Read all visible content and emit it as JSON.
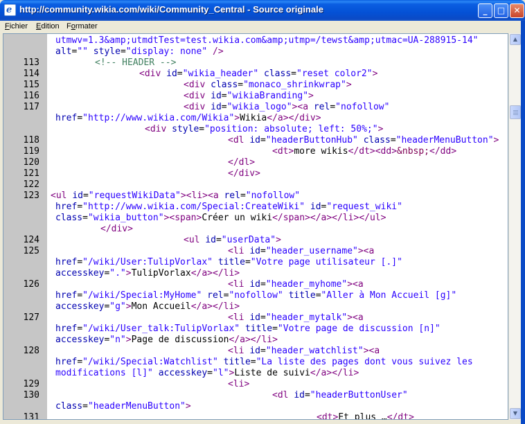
{
  "window": {
    "title": "http://community.wikia.com/wiki/Community_Central - Source originale",
    "icon": "ie-icon",
    "controls": {
      "minimize": "_",
      "maximize": "□",
      "close": "✕"
    }
  },
  "menu": [
    {
      "label": "Fichier",
      "accel": "F"
    },
    {
      "label": "Edition",
      "accel": "E"
    },
    {
      "label": "Formater",
      "accel": "o"
    }
  ],
  "colors": {
    "titlebar": "#0451d6",
    "gutter": "#c6c6c6",
    "tag": "#7f007f",
    "attr_name": "#0000b0",
    "attr_value": "#2a00ff",
    "comment": "#3f7f5f",
    "text": "#000000"
  },
  "source_lines": [
    {
      "num": "",
      "indent": 0,
      "tokens": [
        {
          "t": "utmwv=1.3&amp;utmdtTest=test.wikia.com&amp;utmp=/tewst&amp;utmac=UA-288915-14\"",
          "c": "av"
        }
      ]
    },
    {
      "num": "",
      "indent": 0,
      "tokens": [
        {
          "t": "alt",
          "c": "an"
        },
        {
          "t": "=",
          "c": "tx"
        },
        {
          "t": "\"\"",
          "c": "av"
        },
        {
          "t": " ",
          "c": "tx"
        },
        {
          "t": "style",
          "c": "an"
        },
        {
          "t": "=",
          "c": "tx"
        },
        {
          "t": "\"display: none\"",
          "c": "av"
        },
        {
          "t": " />",
          "c": "tg"
        }
      ]
    },
    {
      "num": "113",
      "indent": 1,
      "tokens": [
        {
          "t": "<!-- HEADER -->",
          "c": "cm"
        }
      ]
    },
    {
      "num": "114",
      "indent": 2,
      "tokens": [
        {
          "t": "<div ",
          "c": "tg"
        },
        {
          "t": "id",
          "c": "an"
        },
        {
          "t": "=",
          "c": "tx"
        },
        {
          "t": "\"wikia_header\"",
          "c": "av"
        },
        {
          "t": " ",
          "c": "tx"
        },
        {
          "t": "class",
          "c": "an"
        },
        {
          "t": "=",
          "c": "tx"
        },
        {
          "t": "\"reset color2\"",
          "c": "av"
        },
        {
          "t": ">",
          "c": "tg"
        }
      ]
    },
    {
      "num": "115",
      "indent": 3,
      "tokens": [
        {
          "t": "<div ",
          "c": "tg"
        },
        {
          "t": "class",
          "c": "an"
        },
        {
          "t": "=",
          "c": "tx"
        },
        {
          "t": "\"monaco_shrinkwrap\"",
          "c": "av"
        },
        {
          "t": ">",
          "c": "tg"
        }
      ]
    },
    {
      "num": "116",
      "indent": 3,
      "tokens": [
        {
          "t": "<div ",
          "c": "tg"
        },
        {
          "t": "id",
          "c": "an"
        },
        {
          "t": "=",
          "c": "tx"
        },
        {
          "t": "\"wikiaBranding\"",
          "c": "av"
        },
        {
          "t": ">",
          "c": "tg"
        }
      ]
    },
    {
      "num": "117",
      "indent": 3,
      "tokens": [
        {
          "t": "<div ",
          "c": "tg"
        },
        {
          "t": "id",
          "c": "an"
        },
        {
          "t": "=",
          "c": "tx"
        },
        {
          "t": "\"wikia_logo\"",
          "c": "av"
        },
        {
          "t": "><a ",
          "c": "tg"
        },
        {
          "t": "rel",
          "c": "an"
        },
        {
          "t": "=",
          "c": "tx"
        },
        {
          "t": "\"nofollow\"",
          "c": "av"
        }
      ]
    },
    {
      "num": "",
      "indent": 0,
      "tokens": [
        {
          "t": "href",
          "c": "an"
        },
        {
          "t": "=",
          "c": "tx"
        },
        {
          "t": "\"http://www.wikia.com/Wikia\"",
          "c": "av"
        },
        {
          "t": ">",
          "c": "tg"
        },
        {
          "t": "Wikia",
          "c": "tx"
        },
        {
          "t": "</a></div>",
          "c": "tg"
        }
      ]
    },
    {
      "num": "",
      "indent": 4,
      "tokens": [
        {
          "t": "<div ",
          "c": "tg"
        },
        {
          "t": "style",
          "c": "an"
        },
        {
          "t": "=",
          "c": "tx"
        },
        {
          "t": "\"position: absolute; left: 50%;\"",
          "c": "av"
        },
        {
          "t": ">",
          "c": "tg"
        }
      ]
    },
    {
      "num": "118",
      "indent": 5,
      "tokens": [
        {
          "t": "<dl ",
          "c": "tg"
        },
        {
          "t": "id",
          "c": "an"
        },
        {
          "t": "=",
          "c": "tx"
        },
        {
          "t": "\"headerButtonHub\"",
          "c": "av"
        },
        {
          "t": " ",
          "c": "tx"
        },
        {
          "t": "class",
          "c": "an"
        },
        {
          "t": "=",
          "c": "tx"
        },
        {
          "t": "\"headerMenuButton\"",
          "c": "av"
        },
        {
          "t": ">",
          "c": "tg"
        }
      ]
    },
    {
      "num": "119",
      "indent": 6,
      "tokens": [
        {
          "t": "<dt>",
          "c": "tg"
        },
        {
          "t": "more wikis",
          "c": "tx"
        },
        {
          "t": "</dt><dd>",
          "c": "tg"
        },
        {
          "t": "&nbsp;",
          "c": "en"
        },
        {
          "t": "</dd>",
          "c": "tg"
        }
      ]
    },
    {
      "num": "120",
      "indent": 5,
      "tokens": [
        {
          "t": "</dl>",
          "c": "tg"
        }
      ]
    },
    {
      "num": "121",
      "indent": 5,
      "tokens": [
        {
          "t": "</div>",
          "c": "tg"
        }
      ]
    },
    {
      "num": "122",
      "indent": 0,
      "tokens": []
    },
    {
      "num": "123",
      "indent": -1,
      "tokens": [
        {
          "t": "<ul ",
          "c": "tg"
        },
        {
          "t": "id",
          "c": "an"
        },
        {
          "t": "=",
          "c": "tx"
        },
        {
          "t": "\"requestWikiData\"",
          "c": "av"
        },
        {
          "t": "><li><a ",
          "c": "tg"
        },
        {
          "t": "rel",
          "c": "an"
        },
        {
          "t": "=",
          "c": "tx"
        },
        {
          "t": "\"nofollow\"",
          "c": "av"
        }
      ]
    },
    {
      "num": "",
      "indent": 0,
      "tokens": [
        {
          "t": "href",
          "c": "an"
        },
        {
          "t": "=",
          "c": "tx"
        },
        {
          "t": "\"http://www.wikia.com/Special:CreateWiki\"",
          "c": "av"
        },
        {
          "t": " ",
          "c": "tx"
        },
        {
          "t": "id",
          "c": "an"
        },
        {
          "t": "=",
          "c": "tx"
        },
        {
          "t": "\"request_wiki\"",
          "c": "av"
        }
      ]
    },
    {
      "num": "",
      "indent": 0,
      "tokens": [
        {
          "t": "class",
          "c": "an"
        },
        {
          "t": "=",
          "c": "tx"
        },
        {
          "t": "\"wikia_button\"",
          "c": "av"
        },
        {
          "t": "><span>",
          "c": "tg"
        },
        {
          "t": "Créer un wiki",
          "c": "tx"
        },
        {
          "t": "</span></a></li></ul>",
          "c": "tg"
        }
      ]
    },
    {
      "num": "",
      "indent": 7,
      "tokens": [
        {
          "t": "</div>",
          "c": "tg"
        }
      ]
    },
    {
      "num": "124",
      "indent": 3,
      "tokens": [
        {
          "t": "<ul ",
          "c": "tg"
        },
        {
          "t": "id",
          "c": "an"
        },
        {
          "t": "=",
          "c": "tx"
        },
        {
          "t": "\"userData\"",
          "c": "av"
        },
        {
          "t": ">",
          "c": "tg"
        }
      ]
    },
    {
      "num": "125",
      "indent": 5,
      "tokens": [
        {
          "t": "<li ",
          "c": "tg"
        },
        {
          "t": "id",
          "c": "an"
        },
        {
          "t": "=",
          "c": "tx"
        },
        {
          "t": "\"header_username\"",
          "c": "av"
        },
        {
          "t": "><a",
          "c": "tg"
        }
      ]
    },
    {
      "num": "",
      "indent": 0,
      "tokens": [
        {
          "t": "href",
          "c": "an"
        },
        {
          "t": "=",
          "c": "tx"
        },
        {
          "t": "\"/wiki/User:TulipVorlax\"",
          "c": "av"
        },
        {
          "t": " ",
          "c": "tx"
        },
        {
          "t": "title",
          "c": "an"
        },
        {
          "t": "=",
          "c": "tx"
        },
        {
          "t": "\"Votre page utilisateur [.]\"",
          "c": "av"
        }
      ]
    },
    {
      "num": "",
      "indent": 0,
      "tokens": [
        {
          "t": "accesskey",
          "c": "an"
        },
        {
          "t": "=",
          "c": "tx"
        },
        {
          "t": "\".\"",
          "c": "av"
        },
        {
          "t": ">",
          "c": "tg"
        },
        {
          "t": "TulipVorlax",
          "c": "tx"
        },
        {
          "t": "</a></li>",
          "c": "tg"
        }
      ]
    },
    {
      "num": "126",
      "indent": 5,
      "tokens": [
        {
          "t": "<li ",
          "c": "tg"
        },
        {
          "t": "id",
          "c": "an"
        },
        {
          "t": "=",
          "c": "tx"
        },
        {
          "t": "\"header_myhome\"",
          "c": "av"
        },
        {
          "t": "><a",
          "c": "tg"
        }
      ]
    },
    {
      "num": "",
      "indent": 0,
      "tokens": [
        {
          "t": "href",
          "c": "an"
        },
        {
          "t": "=",
          "c": "tx"
        },
        {
          "t": "\"/wiki/Special:MyHome\"",
          "c": "av"
        },
        {
          "t": " ",
          "c": "tx"
        },
        {
          "t": "rel",
          "c": "an"
        },
        {
          "t": "=",
          "c": "tx"
        },
        {
          "t": "\"nofollow\"",
          "c": "av"
        },
        {
          "t": " ",
          "c": "tx"
        },
        {
          "t": "title",
          "c": "an"
        },
        {
          "t": "=",
          "c": "tx"
        },
        {
          "t": "\"Aller à Mon Accueil [g]\"",
          "c": "av"
        }
      ]
    },
    {
      "num": "",
      "indent": 0,
      "tokens": [
        {
          "t": "accesskey",
          "c": "an"
        },
        {
          "t": "=",
          "c": "tx"
        },
        {
          "t": "\"g\"",
          "c": "av"
        },
        {
          "t": ">",
          "c": "tg"
        },
        {
          "t": "Mon Accueil",
          "c": "tx"
        },
        {
          "t": "</a></li>",
          "c": "tg"
        }
      ]
    },
    {
      "num": "127",
      "indent": 5,
      "tokens": [
        {
          "t": "<li ",
          "c": "tg"
        },
        {
          "t": "id",
          "c": "an"
        },
        {
          "t": "=",
          "c": "tx"
        },
        {
          "t": "\"header_mytalk\"",
          "c": "av"
        },
        {
          "t": "><a",
          "c": "tg"
        }
      ]
    },
    {
      "num": "",
      "indent": 0,
      "tokens": [
        {
          "t": "href",
          "c": "an"
        },
        {
          "t": "=",
          "c": "tx"
        },
        {
          "t": "\"/wiki/User_talk:TulipVorlax\"",
          "c": "av"
        },
        {
          "t": " ",
          "c": "tx"
        },
        {
          "t": "title",
          "c": "an"
        },
        {
          "t": "=",
          "c": "tx"
        },
        {
          "t": "\"Votre page de discussion [n]\"",
          "c": "av"
        }
      ]
    },
    {
      "num": "",
      "indent": 0,
      "tokens": [
        {
          "t": "accesskey",
          "c": "an"
        },
        {
          "t": "=",
          "c": "tx"
        },
        {
          "t": "\"n\"",
          "c": "av"
        },
        {
          "t": ">",
          "c": "tg"
        },
        {
          "t": "Page de discussion",
          "c": "tx"
        },
        {
          "t": "</a></li>",
          "c": "tg"
        }
      ]
    },
    {
      "num": "128",
      "indent": 5,
      "tokens": [
        {
          "t": "<li ",
          "c": "tg"
        },
        {
          "t": "id",
          "c": "an"
        },
        {
          "t": "=",
          "c": "tx"
        },
        {
          "t": "\"header_watchlist\"",
          "c": "av"
        },
        {
          "t": "><a",
          "c": "tg"
        }
      ]
    },
    {
      "num": "",
      "indent": 0,
      "tokens": [
        {
          "t": "href",
          "c": "an"
        },
        {
          "t": "=",
          "c": "tx"
        },
        {
          "t": "\"/wiki/Special:Watchlist\"",
          "c": "av"
        },
        {
          "t": " ",
          "c": "tx"
        },
        {
          "t": "title",
          "c": "an"
        },
        {
          "t": "=",
          "c": "tx"
        },
        {
          "t": "\"La liste des pages dont vous suivez les",
          "c": "av"
        }
      ]
    },
    {
      "num": "",
      "indent": 0,
      "tokens": [
        {
          "t": "modifications [l]\"",
          "c": "av"
        },
        {
          "t": " ",
          "c": "tx"
        },
        {
          "t": "accesskey",
          "c": "an"
        },
        {
          "t": "=",
          "c": "tx"
        },
        {
          "t": "\"l\"",
          "c": "av"
        },
        {
          "t": ">",
          "c": "tg"
        },
        {
          "t": "Liste de suivi",
          "c": "tx"
        },
        {
          "t": "</a></li>",
          "c": "tg"
        }
      ]
    },
    {
      "num": "129",
      "indent": 5,
      "tokens": [
        {
          "t": "<li>",
          "c": "tg"
        }
      ]
    },
    {
      "num": "130",
      "indent": 6,
      "tokens": [
        {
          "t": "<dl ",
          "c": "tg"
        },
        {
          "t": "id",
          "c": "an"
        },
        {
          "t": "=",
          "c": "tx"
        },
        {
          "t": "\"headerButtonUser\"",
          "c": "av"
        }
      ]
    },
    {
      "num": "",
      "indent": 0,
      "tokens": [
        {
          "t": "class",
          "c": "an"
        },
        {
          "t": "=",
          "c": "tx"
        },
        {
          "t": "\"headerMenuButton\"",
          "c": "av"
        },
        {
          "t": ">",
          "c": "tg"
        }
      ]
    },
    {
      "num": "131",
      "indent": 8,
      "tokens": [
        {
          "t": "<dt>",
          "c": "tg"
        },
        {
          "t": "Et plus …",
          "c": "tx"
        },
        {
          "t": "</dt>",
          "c": "tg"
        }
      ]
    }
  ],
  "scrollbar": {
    "position_fraction": 0.17
  }
}
